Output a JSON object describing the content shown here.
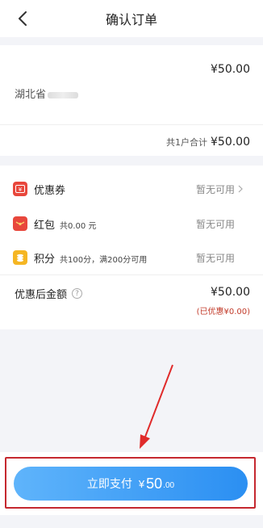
{
  "header": {
    "title": "确认订单"
  },
  "order": {
    "price": "¥50.00",
    "address": "湖北省",
    "total_label": "共1户合计",
    "total_amount": "¥50.00"
  },
  "discounts": {
    "coupon": {
      "label": "优惠券",
      "status": "暂无可用"
    },
    "redpacket": {
      "label": "红包",
      "sub": "共0.00 元",
      "status": "暂无可用"
    },
    "points": {
      "label": "积分",
      "sub": "共100分，满200分可用",
      "status": "暂无可用"
    },
    "final_label": "优惠后金额",
    "final_amount": "¥50.00",
    "saved": "(已优惠¥0.00)"
  },
  "pay_button": {
    "label": "立即支付",
    "currency": "¥",
    "amount_int": "50",
    "amount_dec": ".00"
  },
  "colors": {
    "accent_blue": "#2b8ff2",
    "annotation_red": "#c5282f",
    "saved_red": "#c23b2a"
  }
}
